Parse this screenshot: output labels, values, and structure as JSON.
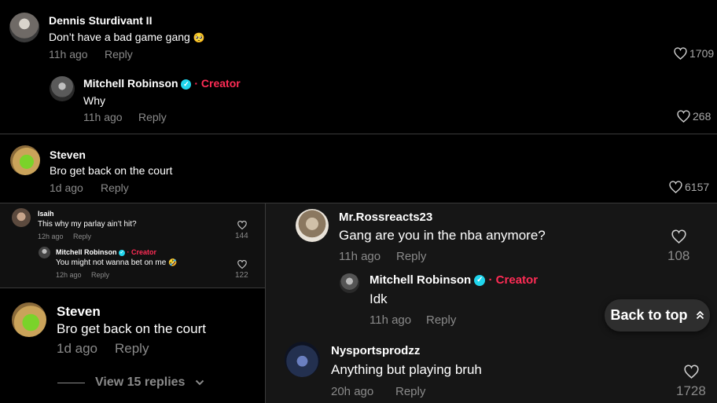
{
  "colors": {
    "accent": "#fe2c55",
    "verified": "#20d5ec",
    "meta": "#8a8a8a",
    "panel": "#161616"
  },
  "top": {
    "c1": {
      "user": "Dennis Sturdivant II",
      "text": "Don’t have a bad game gang",
      "emoji": "🥺",
      "time": "11h ago",
      "reply": "Reply",
      "likes": "1709"
    },
    "r1": {
      "user": "Mitchell Robinson",
      "creator": "· Creator",
      "text": "Why",
      "time": "11h ago",
      "reply": "Reply",
      "likes": "268"
    },
    "c2": {
      "user": "Steven",
      "text": "Bro get back on the court",
      "time": "1d ago",
      "reply": "Reply",
      "likes": "6157"
    }
  },
  "mini": {
    "c1": {
      "user": "Isaih",
      "text": "This why my parlay ain’t hit?",
      "time": "12h ago",
      "reply": "Reply",
      "likes": "144"
    },
    "r1": {
      "user": "Mitchell Robinson",
      "creator": "· Creator",
      "text": "You might not wanna bet on me",
      "emoji": "🤣",
      "time": "12h ago",
      "reply": "Reply",
      "likes": "122"
    }
  },
  "left": {
    "c1": {
      "user": "Steven",
      "text": "Bro get back on the court",
      "time": "1d ago",
      "reply": "Reply",
      "view": "View 15 replies"
    }
  },
  "right": {
    "c1": {
      "user": "Mr.Rossreacts23",
      "text": "Gang are you in the nba anymore?",
      "time": "11h ago",
      "reply": "Reply",
      "likes": "108"
    },
    "r1": {
      "user": "Mitchell Robinson",
      "creator": "· Creator",
      "text": "Idk",
      "time": "11h ago",
      "reply": "Reply"
    },
    "c2": {
      "user": "Nysportsprodzz",
      "text": "Anything but playing bruh",
      "time": "20h ago",
      "reply": "Reply",
      "likes": "1728"
    }
  },
  "back_to_top": "Back to top",
  "icons": [
    "heart-icon",
    "verified-icon",
    "chevron-down-icon",
    "double-chevron-up-icon"
  ]
}
